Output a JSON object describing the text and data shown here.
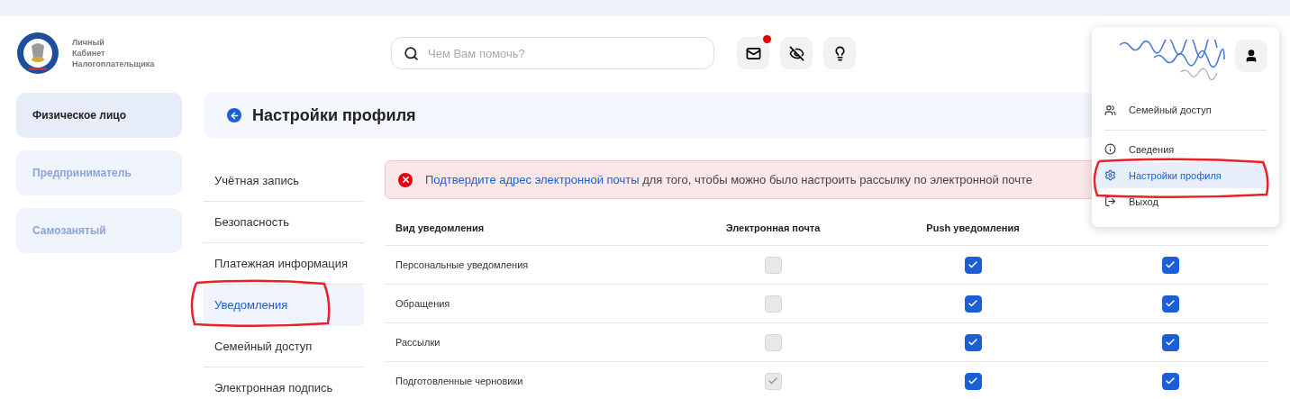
{
  "logo": {
    "lines": [
      "Личный",
      "Кабинет",
      "Налогоплательщика"
    ]
  },
  "search": {
    "placeholder": "Чем Вам помочь?"
  },
  "header_buttons": [
    {
      "kind": "mail",
      "badge": true
    },
    {
      "kind": "eye-off",
      "badge": false
    },
    {
      "kind": "bulb",
      "badge": false
    }
  ],
  "account_types": [
    {
      "label": "Физическое лицо",
      "selected": true
    },
    {
      "label": "Предприниматель",
      "selected": false
    },
    {
      "label": "Самозанятый",
      "selected": false
    }
  ],
  "page_title": "Настройки профиля",
  "subnav": [
    {
      "label": "Учётная запись",
      "selected": false,
      "highlighted": false
    },
    {
      "label": "Безопасность",
      "selected": false,
      "highlighted": false
    },
    {
      "label": "Платежная информация",
      "selected": false,
      "highlighted": false
    },
    {
      "label": "Уведомления",
      "selected": true,
      "highlighted": true
    },
    {
      "label": "Семейный доступ",
      "selected": false,
      "highlighted": false
    },
    {
      "label": "Электронная подпись",
      "selected": false,
      "highlighted": false
    }
  ],
  "alert": {
    "link": "Подтвердите адрес электронной почты",
    "text": " для того, чтобы можно было настроить рассылку по электронной почте"
  },
  "table": {
    "columns": [
      "Вид уведомления",
      "Электронная почта",
      "Push уведомления"
    ],
    "rows": [
      {
        "name": "Персональные уведомления",
        "email": {
          "checked": false,
          "disabled": true
        },
        "push": {
          "checked": true,
          "disabled": false
        },
        "lk": {
          "checked": true,
          "disabled": false
        }
      },
      {
        "name": "Обращения",
        "email": {
          "checked": false,
          "disabled": true
        },
        "push": {
          "checked": true,
          "disabled": false
        },
        "lk": {
          "checked": true,
          "disabled": false
        }
      },
      {
        "name": "Рассылки",
        "email": {
          "checked": false,
          "disabled": true
        },
        "push": {
          "checked": true,
          "disabled": false
        },
        "lk": {
          "checked": true,
          "disabled": false
        }
      },
      {
        "name": "Подготовленные черновики",
        "email": {
          "checked": true,
          "disabled": true
        },
        "push": {
          "checked": true,
          "disabled": false
        },
        "lk": {
          "checked": true,
          "disabled": false
        }
      }
    ]
  },
  "profile_menu": {
    "items": [
      {
        "kind": "family",
        "label": "Семейный доступ",
        "selected": false,
        "highlighted": false
      },
      {
        "kind": "info",
        "label": "Сведения",
        "selected": false,
        "highlighted": false
      },
      {
        "kind": "settings",
        "label": "Настройки профиля",
        "selected": true,
        "highlighted": true
      },
      {
        "kind": "logout",
        "label": "Выход",
        "selected": false,
        "highlighted": false
      }
    ]
  }
}
